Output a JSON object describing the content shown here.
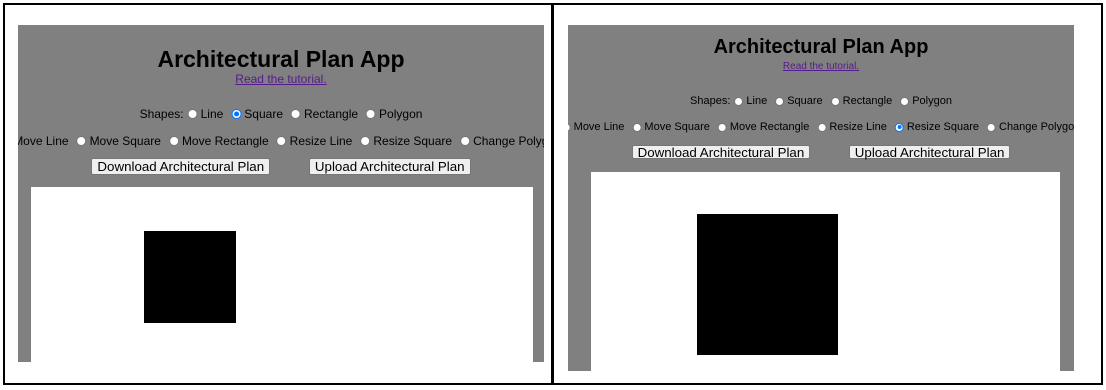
{
  "app": {
    "title": "Architectural Plan App",
    "tutorial_link": "Read the tutorial.",
    "shapes_label": "Shapes:",
    "shape_options": [
      "Line",
      "Square",
      "Rectangle",
      "Polygon"
    ],
    "action_options": [
      "Move Line",
      "Move Square",
      "Move Rectangle",
      "Resize Line",
      "Resize Square",
      "Change Polygon"
    ],
    "download_button": "Download Architectural Plan",
    "upload_button": "Upload Architectural Plan"
  },
  "screens": [
    {
      "selected_shape": "Square",
      "selected_action": ""
    },
    {
      "selected_shape": "",
      "selected_action": "Resize Square"
    }
  ],
  "colors": {
    "panel_background": "#808080",
    "canvas_background": "#ffffff",
    "shape_fill": "#000000",
    "link": "#551a8b",
    "radio_checked": "#0075ff"
  }
}
